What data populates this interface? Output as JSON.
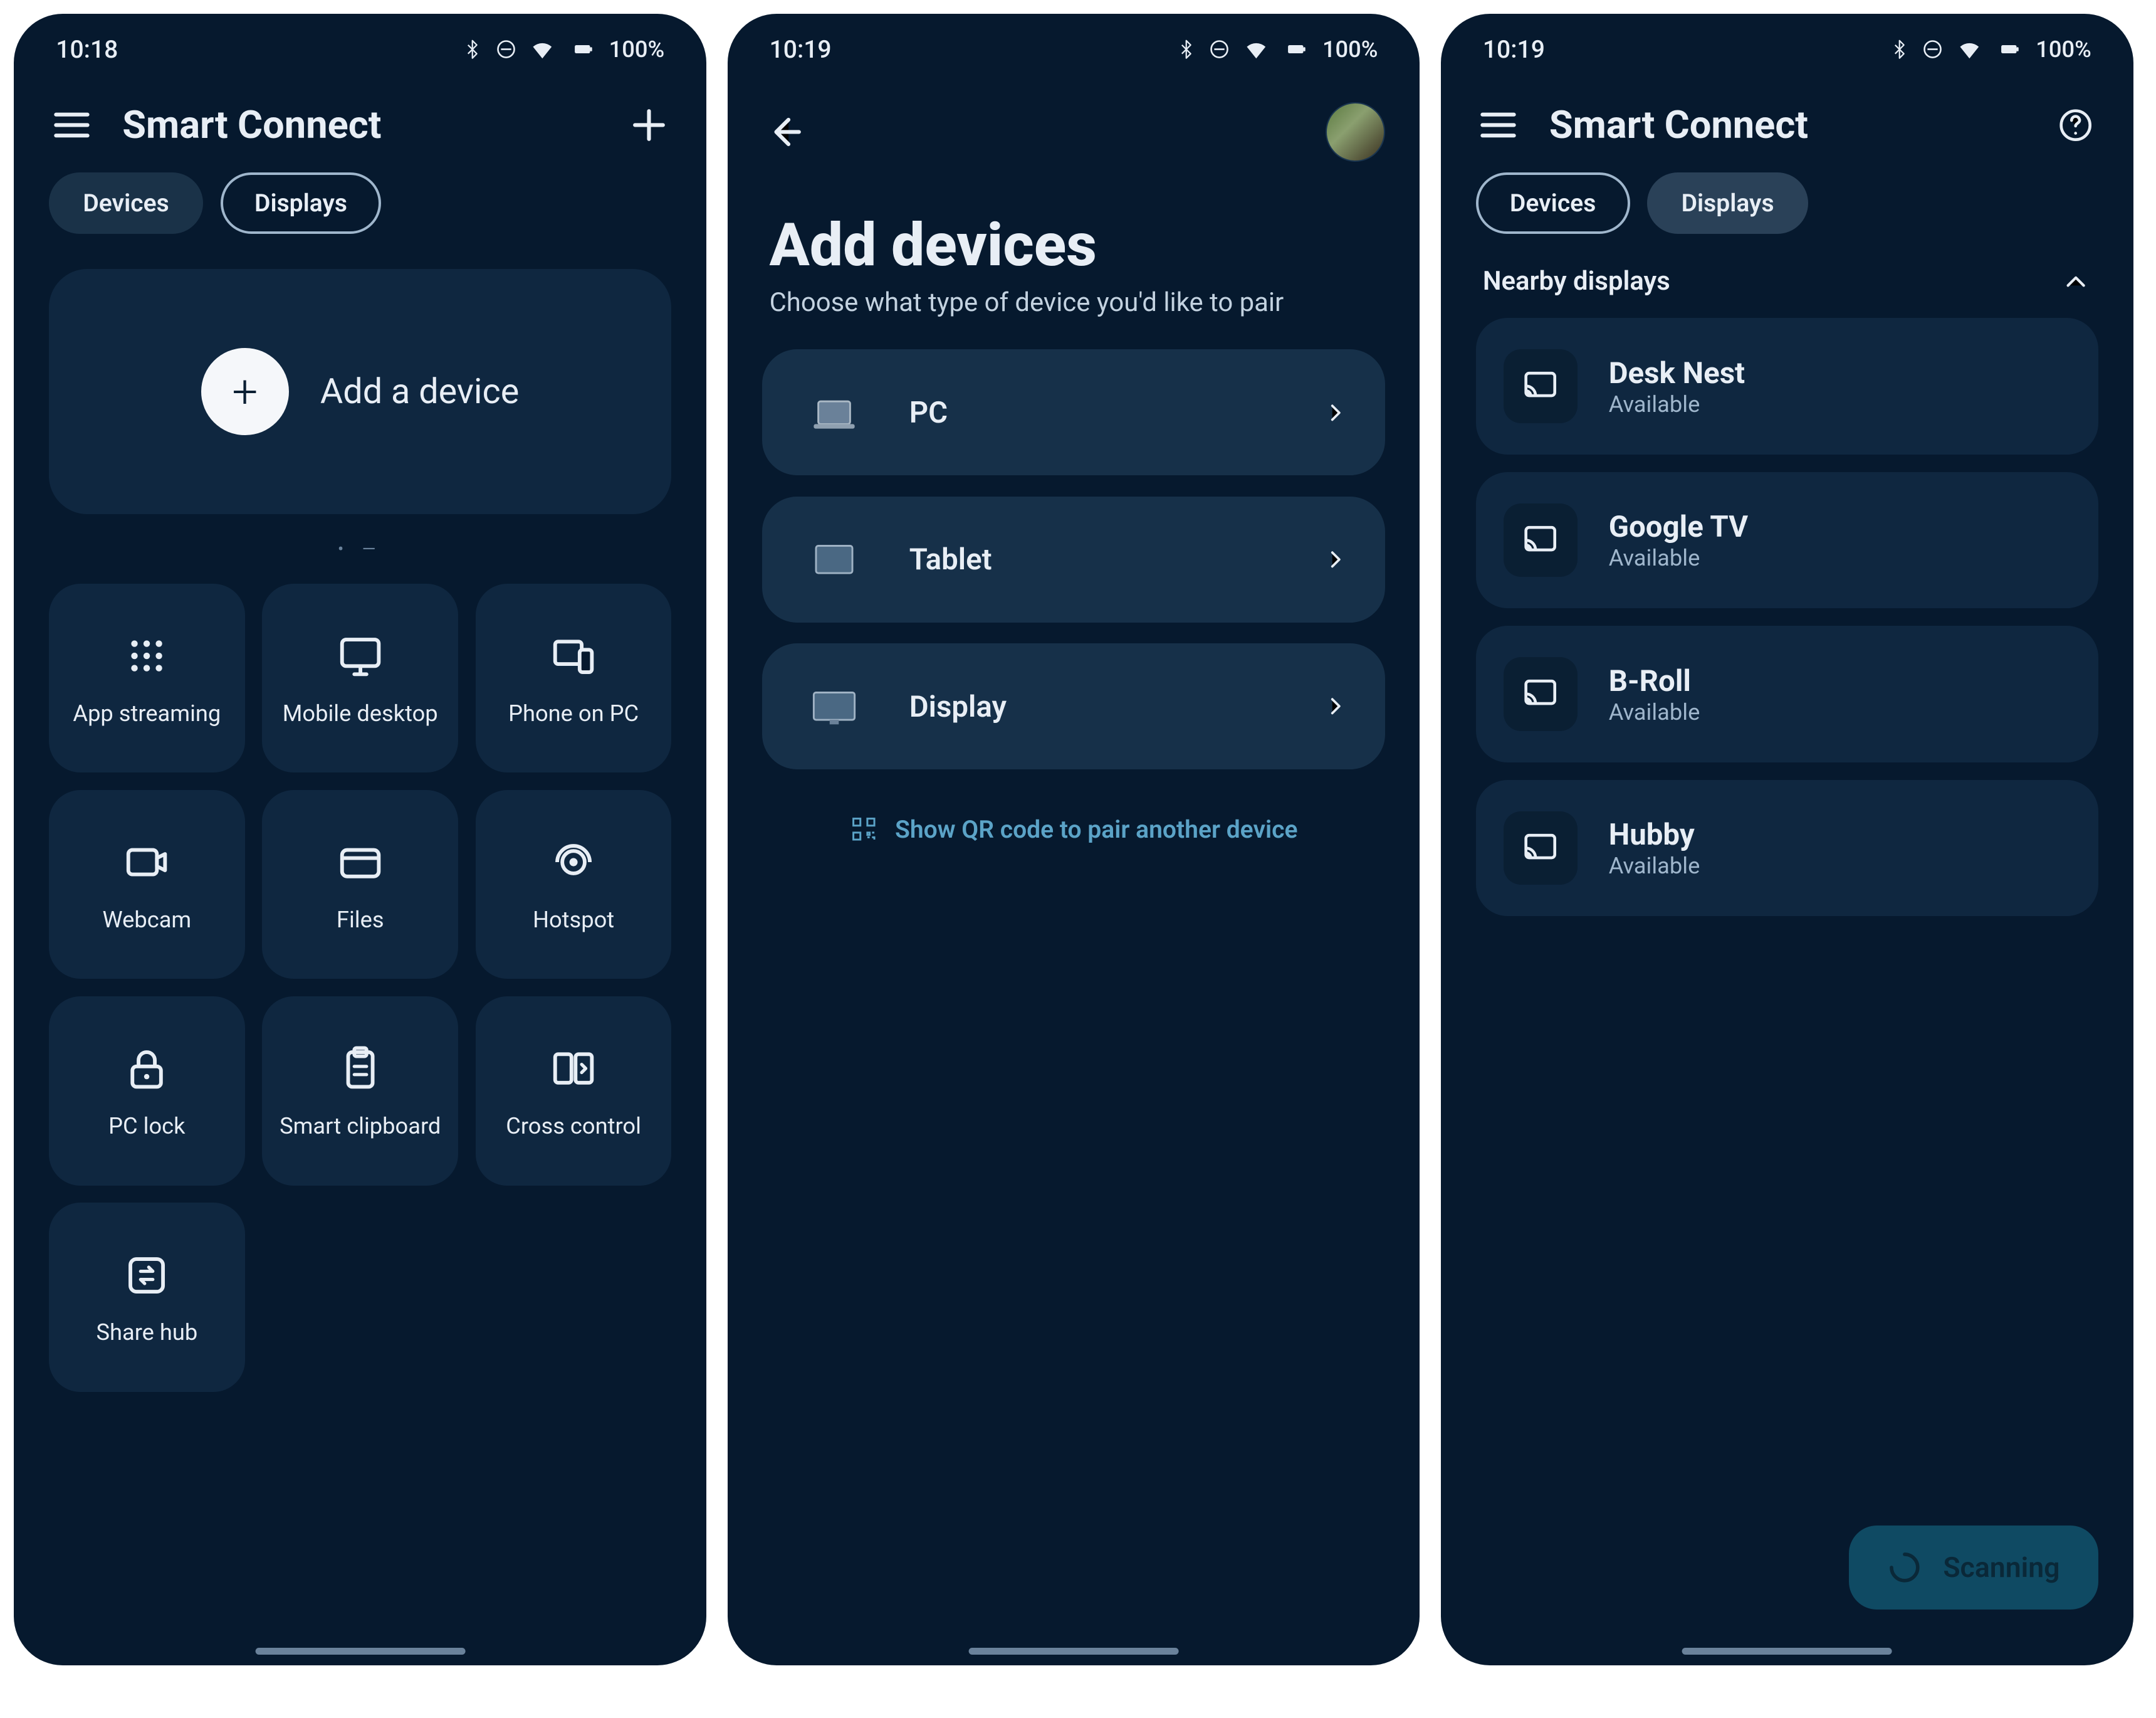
{
  "panel1": {
    "time": "10:18",
    "battery": "100%",
    "title": "Smart Connect",
    "tabs": {
      "devices": "Devices",
      "displays": "Displays",
      "active": "devices"
    },
    "add_card": "Add a device",
    "tiles": [
      {
        "id": "app-streaming",
        "label": "App streaming",
        "icon": "grid-dots"
      },
      {
        "id": "mobile-desktop",
        "label": "Mobile desktop",
        "icon": "monitor"
      },
      {
        "id": "phone-on-pc",
        "label": "Phone on PC",
        "icon": "phone-pc"
      },
      {
        "id": "webcam",
        "label": "Webcam",
        "icon": "camera"
      },
      {
        "id": "files",
        "label": "Files",
        "icon": "folder"
      },
      {
        "id": "hotspot",
        "label": "Hotspot",
        "icon": "broadcast"
      },
      {
        "id": "pc-lock",
        "label": "PC lock",
        "icon": "lock"
      },
      {
        "id": "smart-clipboard",
        "label": "Smart clipboard",
        "icon": "clipboard"
      },
      {
        "id": "cross-control",
        "label": "Cross control",
        "icon": "cross-ctrl"
      },
      {
        "id": "share-hub",
        "label": "Share hub",
        "icon": "swap"
      }
    ]
  },
  "panel2": {
    "time": "10:19",
    "battery": "100%",
    "title": "Add devices",
    "subtitle": "Choose what type of device you'd like to pair",
    "options": [
      {
        "id": "pc",
        "label": "PC",
        "icon": "laptop"
      },
      {
        "id": "tablet",
        "label": "Tablet",
        "icon": "tablet"
      },
      {
        "id": "display",
        "label": "Display",
        "icon": "display"
      }
    ],
    "qr_link": "Show QR code to pair another device"
  },
  "panel3": {
    "time": "10:19",
    "battery": "100%",
    "title": "Smart Connect",
    "tabs": {
      "devices": "Devices",
      "displays": "Displays",
      "active": "displays"
    },
    "section": "Nearby displays",
    "displays": [
      {
        "name": "Desk Nest",
        "status": "Available"
      },
      {
        "name": "Google TV",
        "status": "Available"
      },
      {
        "name": "B-Roll",
        "status": "Available"
      },
      {
        "name": "Hubby",
        "status": "Available"
      }
    ],
    "scanning": "Scanning"
  }
}
